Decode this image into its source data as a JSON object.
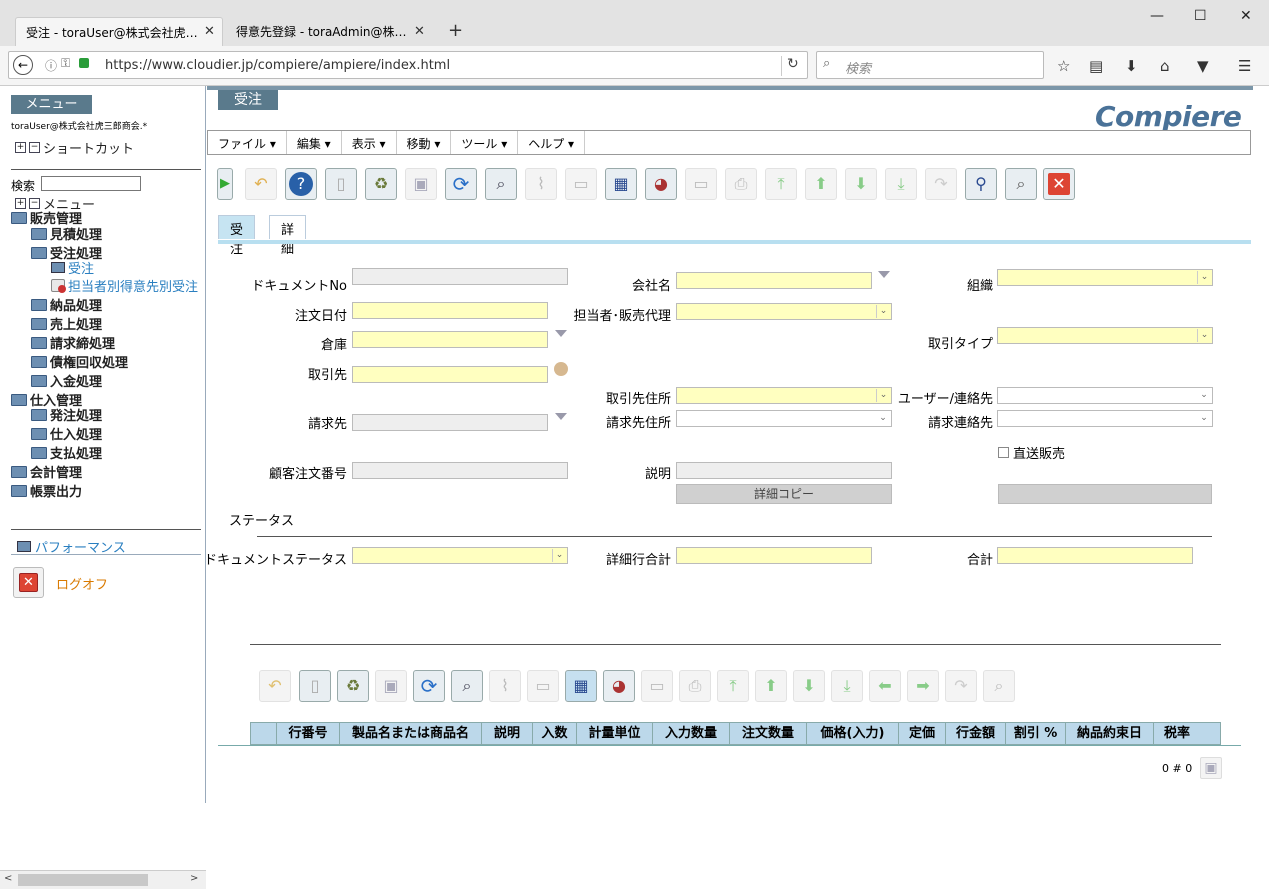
{
  "browser": {
    "tabs": [
      {
        "label": "受注 - toraUser@株式会社虎…"
      },
      {
        "label": "得意先登録 - toraAdmin@株…"
      }
    ],
    "new_tab": "+",
    "url": "https://www.cloudier.jp/compiere/ampiere/index.html",
    "search_placeholder": "検索"
  },
  "sidebar": {
    "menu_header": "メニュー",
    "user": "toraUser@株式会社虎三郎商会.*",
    "shortcut_label": "ショートカット",
    "search_label": "検索",
    "menu_label": "メニュー",
    "tree": [
      {
        "label": "販売管理"
      },
      {
        "label": "見積処理"
      },
      {
        "label": "受注処理"
      },
      {
        "label": "受注"
      },
      {
        "label": "担当者別得意先別受注"
      },
      {
        "label": "納品処理"
      },
      {
        "label": "売上処理"
      },
      {
        "label": "請求締処理"
      },
      {
        "label": "債権回収処理"
      },
      {
        "label": "入金処理"
      },
      {
        "label": "仕入管理"
      },
      {
        "label": "発注処理"
      },
      {
        "label": "仕入処理"
      },
      {
        "label": "支払処理"
      },
      {
        "label": "会計管理"
      },
      {
        "label": "帳票出力"
      }
    ],
    "performance": "パフォーマンス",
    "logoff": "ログオフ"
  },
  "window": {
    "title": "受注",
    "logo": "Compiere",
    "menus": [
      "ファイル ▾",
      "編集 ▾",
      "表示 ▾",
      "移動 ▾",
      "ツール ▾",
      "ヘルプ ▾"
    ],
    "tabs": [
      "受注",
      "詳細"
    ]
  },
  "form": {
    "document_no": "ドキュメントNo",
    "order_date": "注文日付",
    "warehouse": "倉庫",
    "partner": "取引先",
    "bill_to": "請求先",
    "customer_po": "顧客注文番号",
    "company": "会社名",
    "sales_rep": "担当者･販売代理",
    "partner_location": "取引先住所",
    "bill_location": "請求先住所",
    "description": "説明",
    "copy_lines": "詳細コピー",
    "org": "組織",
    "doc_type": "取引タイプ",
    "user_contact": "ユーザー/連絡先",
    "bill_contact": "請求連絡先",
    "drop_ship": "直送販売",
    "status_section": "ステータス",
    "doc_status": "ドキュメントステータス",
    "line_total": "詳細行合計",
    "grand_total": "合計"
  },
  "grid": {
    "columns": [
      "行番号",
      "製品名または商品名",
      "説明",
      "入数",
      "計量単位",
      "入力数量",
      "注文数量",
      "価格(入力)",
      "定価",
      "行金額",
      "割引 %",
      "納品約束日",
      "税率"
    ],
    "record_count": "0 # 0"
  }
}
